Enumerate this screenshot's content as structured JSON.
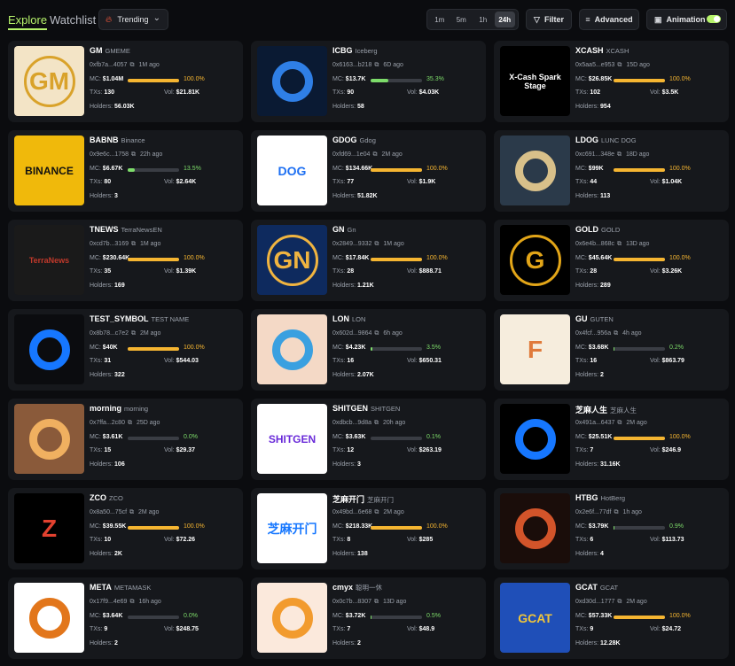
{
  "tabs": {
    "explore": "Explore",
    "watchlist": "Watchlist"
  },
  "sort_select": {
    "value": "Trending"
  },
  "timeframes": [
    "1m",
    "5m",
    "1h",
    "24h"
  ],
  "active_timeframe": "24h",
  "buttons": {
    "filter": "Filter",
    "advanced": "Advanced",
    "animation": "Animation"
  },
  "labels": {
    "mc": "MC:",
    "txs": "TXs:",
    "vol": "Vol:",
    "holders": "Holders:"
  },
  "colors": {
    "accent": "#b6f36b",
    "gold": "#f5b531",
    "green": "#7ddc6a",
    "track": "#3a3d44"
  },
  "tokens": [
    {
      "symbol": "GM",
      "name": "GMEME",
      "address": "0xfb7a...4057",
      "age": "1M ago",
      "mc": "$1.04M",
      "progress": 1.0,
      "pct": "100.0%",
      "txs": "130",
      "vol": "$21.81K",
      "holders": "56.03K",
      "thumb_text": "GM",
      "thumb_bg": "#f3e4c6",
      "thumb_fg": "#d9a22a"
    },
    {
      "symbol": "ICBG",
      "name": "Iceberg",
      "address": "0x6163...b218",
      "age": "6D ago",
      "mc": "$13.7K",
      "progress": 0.353,
      "pct": "35.3%",
      "txs": "90",
      "vol": "$4.03K",
      "holders": "58",
      "thumb_text": "",
      "thumb_bg": "#0a1a33",
      "thumb_fg": "#2f7fe6"
    },
    {
      "symbol": "XCASH",
      "name": "XCASH",
      "address": "0x5aa5...e953",
      "age": "15D ago",
      "mc": "$26.85K",
      "progress": 1.0,
      "pct": "100.0%",
      "txs": "102",
      "vol": "$3.5K",
      "holders": "954",
      "thumb_text": "X-Cash Spark Stage",
      "thumb_bg": "#000000",
      "thumb_fg": "#ffffff"
    },
    {
      "symbol": "BABNB",
      "name": "Binance",
      "address": "0x9e6c...1758",
      "age": "22h ago",
      "mc": "$6.67K",
      "progress": 0.135,
      "pct": "13.5%",
      "txs": "80",
      "vol": "$2.64K",
      "holders": "3",
      "thumb_text": "BINANCE",
      "thumb_bg": "#f0b90b",
      "thumb_fg": "#111111"
    },
    {
      "symbol": "GDOG",
      "name": "Gdog",
      "address": "0xfd69...1e04",
      "age": "2M ago",
      "mc": "$134.66K",
      "progress": 1.0,
      "pct": "100.0%",
      "txs": "77",
      "vol": "$1.9K",
      "holders": "51.82K",
      "thumb_text": "DOG",
      "thumb_bg": "#ffffff",
      "thumb_fg": "#1d6ff2"
    },
    {
      "symbol": "LDOG",
      "name": "LUNC DOG",
      "address": "0xc691...348e",
      "age": "18D ago",
      "mc": "$99K",
      "progress": 1.0,
      "pct": "100.0%",
      "txs": "44",
      "vol": "$1.04K",
      "holders": "113",
      "thumb_text": "",
      "thumb_bg": "#2b3a4a",
      "thumb_fg": "#d8c08a"
    },
    {
      "symbol": "TNEWS",
      "name": "TerraNewsEN",
      "address": "0xcd7b...3169",
      "age": "1M ago",
      "mc": "$230.64K",
      "progress": 1.0,
      "pct": "100.0%",
      "txs": "35",
      "vol": "$1.39K",
      "holders": "169",
      "thumb_text": "TerraNews",
      "thumb_bg": "#1a1a1a",
      "thumb_fg": "#c0392b"
    },
    {
      "symbol": "GN",
      "name": "Gn",
      "address": "0x2849...9332",
      "age": "1M ago",
      "mc": "$17.84K",
      "progress": 1.0,
      "pct": "100.0%",
      "txs": "28",
      "vol": "$888.71",
      "holders": "1.21K",
      "thumb_text": "GN",
      "thumb_bg": "#0e2a5e",
      "thumb_fg": "#f0b440"
    },
    {
      "symbol": "GOLD",
      "name": "GOLD",
      "address": "0x6e4b...868c",
      "age": "13D ago",
      "mc": "$45.64K",
      "progress": 1.0,
      "pct": "100.0%",
      "txs": "28",
      "vol": "$3.26K",
      "holders": "289",
      "thumb_text": "G",
      "thumb_bg": "#000000",
      "thumb_fg": "#e2a518"
    },
    {
      "symbol": "TEST_SYMBOL",
      "name": "TEST NAME",
      "address": "0x8b78...c7e2",
      "age": "2M ago",
      "mc": "$40K",
      "progress": 1.0,
      "pct": "100.0%",
      "txs": "31",
      "vol": "$544.03",
      "holders": "322",
      "thumb_text": "",
      "thumb_bg": "#0b0c0f",
      "thumb_fg": "#1677ff"
    },
    {
      "symbol": "LON",
      "name": "LON",
      "address": "0x602d...9864",
      "age": "6h ago",
      "mc": "$4.23K",
      "progress": 0.035,
      "pct": "3.5%",
      "txs": "16",
      "vol": "$650.31",
      "holders": "2.07K",
      "thumb_text": "",
      "thumb_bg": "#f4d9c6",
      "thumb_fg": "#3aa0e0"
    },
    {
      "symbol": "GU",
      "name": "GUTEN",
      "address": "0x4fcf...956a",
      "age": "4h ago",
      "mc": "$3.68K",
      "progress": 0.002,
      "pct": "0.2%",
      "txs": "16",
      "vol": "$863.79",
      "holders": "2",
      "thumb_text": "F",
      "thumb_bg": "#f6eddd",
      "thumb_fg": "#e07a3a"
    },
    {
      "symbol": "morning",
      "name": "morning",
      "address": "0x7ffa...2c80",
      "age": "25D ago",
      "mc": "$3.61K",
      "progress": 0.0,
      "pct": "0.0%",
      "txs": "15",
      "vol": "$29.37",
      "holders": "106",
      "thumb_text": "",
      "thumb_bg": "#8a5a3a",
      "thumb_fg": "#f0b060"
    },
    {
      "symbol": "SHITGEN",
      "name": "SHITGEN",
      "address": "0xdbcb...9d8a",
      "age": "20h ago",
      "mc": "$3.63K",
      "progress": 0.001,
      "pct": "0.1%",
      "txs": "12",
      "vol": "$263.19",
      "holders": "3",
      "thumb_text": "SHITGEN",
      "thumb_bg": "#ffffff",
      "thumb_fg": "#6a2bd9"
    },
    {
      "symbol": "芝麻人生",
      "name": "芝麻人生",
      "address": "0x491a...6437",
      "age": "2M ago",
      "mc": "$25.51K",
      "progress": 1.0,
      "pct": "100.0%",
      "txs": "7",
      "vol": "$246.9",
      "holders": "31.16K",
      "thumb_text": "",
      "thumb_bg": "#000000",
      "thumb_fg": "#1677ff"
    },
    {
      "symbol": "ZCO",
      "name": "ZCO",
      "address": "0x8a50...75cf",
      "age": "2M ago",
      "mc": "$39.55K",
      "progress": 1.0,
      "pct": "100.0%",
      "txs": "10",
      "vol": "$72.26",
      "holders": "2K",
      "thumb_text": "Z",
      "thumb_bg": "#000000",
      "thumb_fg": "#e2412f"
    },
    {
      "symbol": "芝麻开门",
      "name": "芝麻开门",
      "address": "0x49bd...6e68",
      "age": "2M ago",
      "mc": "$218.33K",
      "progress": 1.0,
      "pct": "100.0%",
      "txs": "8",
      "vol": "$285",
      "holders": "138",
      "thumb_text": "芝麻开门",
      "thumb_bg": "#ffffff",
      "thumb_fg": "#1677ff"
    },
    {
      "symbol": "HTBG",
      "name": "HotBerg",
      "address": "0x2e6f...77df",
      "age": "1h ago",
      "mc": "$3.79K",
      "progress": 0.009,
      "pct": "0.9%",
      "txs": "6",
      "vol": "$113.73",
      "holders": "4",
      "thumb_text": "",
      "thumb_bg": "#1a0d0a",
      "thumb_fg": "#d2542a"
    },
    {
      "symbol": "META",
      "name": "METAMASK",
      "address": "0x17f9...4e69",
      "age": "16h ago",
      "mc": "$3.64K",
      "progress": 0.0,
      "pct": "0.0%",
      "txs": "9",
      "vol": "$248.75",
      "holders": "2",
      "thumb_text": "",
      "thumb_bg": "#ffffff",
      "thumb_fg": "#e2761b"
    },
    {
      "symbol": "cmyx",
      "name": "聪明一休",
      "address": "0x0c7b...8307",
      "age": "13D ago",
      "mc": "$3.72K",
      "progress": 0.005,
      "pct": "0.5%",
      "txs": "7",
      "vol": "$48.9",
      "holders": "2",
      "thumb_text": "",
      "thumb_bg": "#fbe9dc",
      "thumb_fg": "#f29b2e"
    },
    {
      "symbol": "GCAT",
      "name": "GCAT",
      "address": "0xd30d...1777",
      "age": "2M ago",
      "mc": "$57.33K",
      "progress": 1.0,
      "pct": "100.0%",
      "txs": "9",
      "vol": "$24.72",
      "holders": "12.28K",
      "thumb_text": "GCAT",
      "thumb_bg": "#1f4fb8",
      "thumb_fg": "#f0c53a"
    }
  ]
}
